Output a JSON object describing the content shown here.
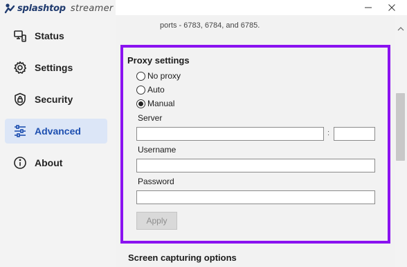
{
  "app": {
    "brand": "splashtop",
    "product": "streamer"
  },
  "window_controls": {
    "minimize_icon": "minimize-icon",
    "close_icon": "close-icon"
  },
  "sidebar": {
    "items": [
      {
        "label": "Status",
        "icon": "status-monitor-icon",
        "active": false
      },
      {
        "label": "Settings",
        "icon": "gear-icon",
        "active": false
      },
      {
        "label": "Security",
        "icon": "shield-lock-icon",
        "active": false
      },
      {
        "label": "Advanced",
        "icon": "sliders-icon",
        "active": true
      },
      {
        "label": "About",
        "icon": "info-icon",
        "active": false
      }
    ]
  },
  "main": {
    "ports_text": "ports - 6783, 6784, and 6785.",
    "proxy": {
      "title": "Proxy settings",
      "options": [
        {
          "label": "No proxy",
          "checked": false
        },
        {
          "label": "Auto",
          "checked": false
        },
        {
          "label": "Manual",
          "checked": true
        }
      ],
      "server_label": "Server",
      "server_value": "",
      "port_separator": ":",
      "port_value": "",
      "username_label": "Username",
      "username_value": "",
      "password_label": "Password",
      "password_value": "",
      "apply_label": "Apply"
    },
    "next_section_title": "Screen capturing options"
  },
  "colors": {
    "highlight_border": "#8a12f0",
    "active_nav_bg": "#dce6f7",
    "active_nav_text": "#1d4fb0",
    "brand_blue": "#1f3a6e"
  }
}
